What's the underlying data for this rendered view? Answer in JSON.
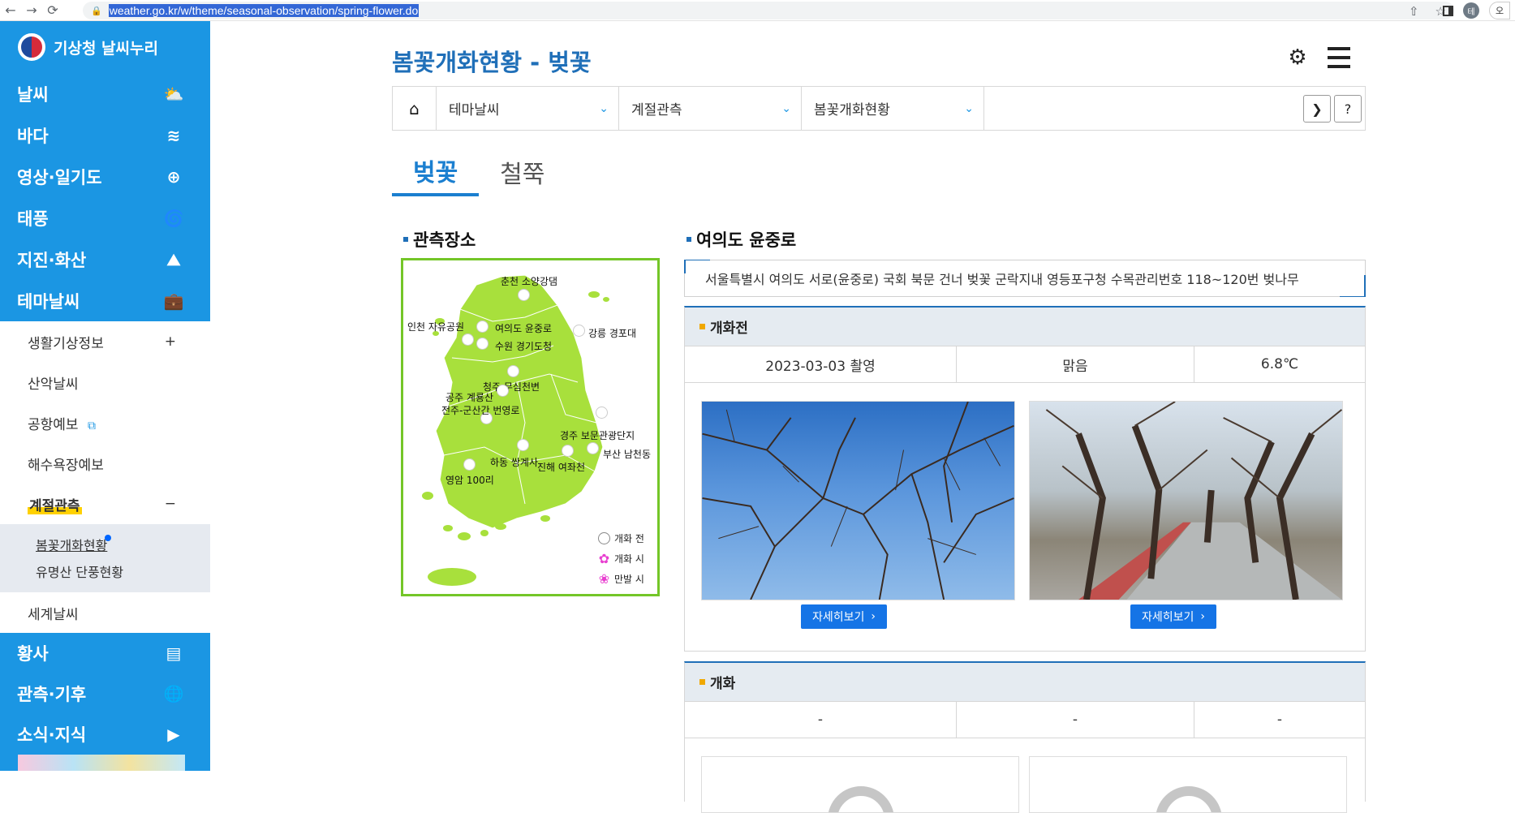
{
  "browser": {
    "back_icon": "arrow-left-icon",
    "forward_icon": "arrow-right-icon",
    "reload_icon": "reload-icon",
    "url": "weather.go.kr/w/theme/seasonal-observation/spring-flower.do",
    "avatar_letter": "테",
    "more_label": "오"
  },
  "sidebar": {
    "brand": "기상청 날씨누리",
    "main_items": [
      {
        "label": "날씨",
        "icon": "sun-cloud-icon"
      },
      {
        "label": "바다",
        "icon": "wave-icon"
      },
      {
        "label": "영상·일기도",
        "icon": "satellite-icon"
      },
      {
        "label": "태풍",
        "icon": "typhoon-icon"
      },
      {
        "label": "지진·화산",
        "icon": "earthquake-icon"
      },
      {
        "label": "테마날씨",
        "icon": "briefcase-icon"
      }
    ],
    "sub_items": [
      {
        "label": "생활기상정보",
        "toggle": "+"
      },
      {
        "label": "산악날씨"
      },
      {
        "label": "공항예보"
      },
      {
        "label": "해수욕장예보"
      },
      {
        "label": "계절관측",
        "toggle": "−"
      }
    ],
    "third_items": [
      {
        "label": "봄꽃개화현황"
      },
      {
        "label": "유명산 단풍현황"
      }
    ],
    "world_item": "세계날씨",
    "bottom_items": [
      {
        "label": "황사",
        "icon": "dust-icon"
      },
      {
        "label": "관측·기후",
        "icon": "globe-icon"
      },
      {
        "label": "소식·지식",
        "icon": "play-icon"
      }
    ]
  },
  "page": {
    "title": "봄꽃개화현황 - 벚꽃",
    "breadcrumb": [
      "테마날씨",
      "계절관측",
      "봄꽃개화현황"
    ],
    "help_label": "?",
    "tabs": [
      "벚꽃",
      "철쭉"
    ]
  },
  "map": {
    "heading": "관측장소",
    "locations": [
      "춘천 소양강댐",
      "인천 자유공원",
      "여의도 윤중로",
      "강릉 경포대",
      "수원 경기도청",
      "청주 무심천변",
      "공주 계룡산",
      "전주-군산간 번영로",
      "경주 보문관광단지",
      "부산 남천동",
      "하동 쌍계사",
      "진해 여좌천",
      "영암 100리"
    ],
    "legend": [
      "개화 전",
      "개화 시",
      "만발 시"
    ]
  },
  "detail": {
    "heading": "여의도 윤중로",
    "description": "서울특별시 여의도 서로(윤중로) 국회 북문 건너 벚꽃 군락지내 영등포구청 수목관리번호 118~120번 벚나무",
    "before": {
      "label": "개화전",
      "date": "2023-03-03 촬영",
      "weather": "맑음",
      "temperature": "6.8℃",
      "button": "자세히보기"
    },
    "bloom": {
      "label": "개화",
      "date": "-",
      "weather": "-",
      "temperature": "-"
    }
  }
}
